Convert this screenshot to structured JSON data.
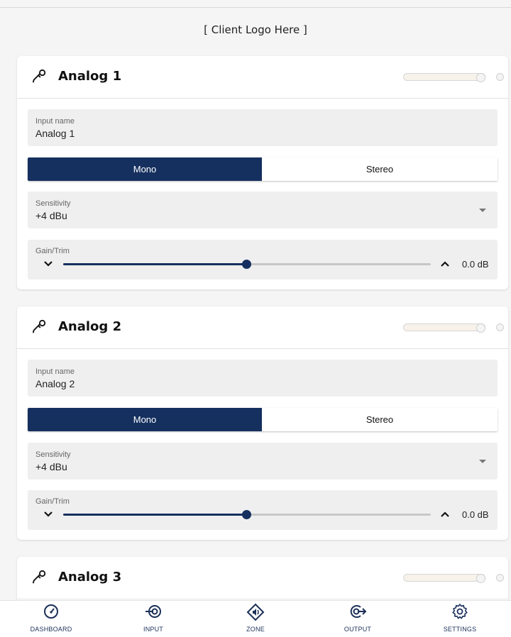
{
  "header": {
    "logo_text": "[ Client Logo Here ]"
  },
  "colors": {
    "primary": "#15305f",
    "field_bg": "#efefef",
    "meter_fill": "#f7f2ea"
  },
  "inputs": [
    {
      "title": "Analog 1",
      "icon": "microphone-icon",
      "name_label": "Input name",
      "name_value": "Analog 1",
      "mode_options": [
        "Mono",
        "Stereo"
      ],
      "mode_selected": "Mono",
      "sensitivity_label": "Sensitivity",
      "sensitivity_value": "+4 dBu",
      "gain_label": "Gain/Trim",
      "gain_value": "0.0 dB",
      "gain_fraction": 0.5
    },
    {
      "title": "Analog 2",
      "icon": "microphone-icon",
      "name_label": "Input name",
      "name_value": "Analog 2",
      "mode_options": [
        "Mono",
        "Stereo"
      ],
      "mode_selected": "Mono",
      "sensitivity_label": "Sensitivity",
      "sensitivity_value": "+4 dBu",
      "gain_label": "Gain/Trim",
      "gain_value": "0.0 dB",
      "gain_fraction": 0.5
    },
    {
      "title": "Analog 3",
      "icon": "microphone-icon"
    }
  ],
  "nav": {
    "items": [
      {
        "label": "DASHBOARD",
        "icon": "gauge-icon"
      },
      {
        "label": "INPUT",
        "icon": "input-icon"
      },
      {
        "label": "ZONE",
        "icon": "speaker-zone-icon"
      },
      {
        "label": "OUTPUT",
        "icon": "output-icon"
      },
      {
        "label": "SETTINGS",
        "icon": "gear-icon"
      }
    ]
  }
}
